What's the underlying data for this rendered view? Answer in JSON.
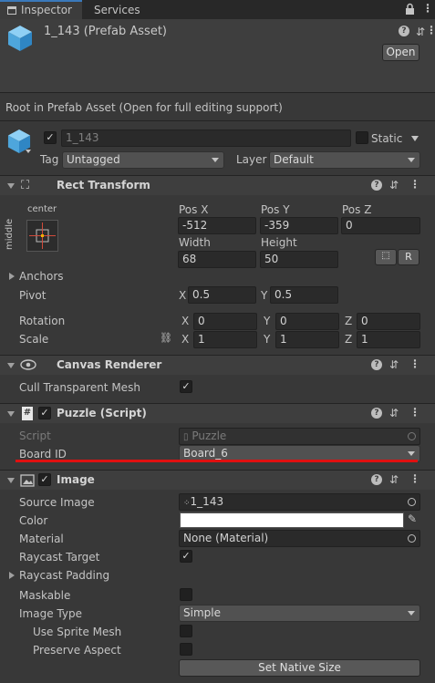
{
  "tabs": {
    "inspector": "Inspector",
    "services": "Services"
  },
  "header": {
    "asset_title": "1_143 (Prefab Asset)",
    "open_button": "Open",
    "info_text": "Root in Prefab Asset (Open for full editing support)"
  },
  "gameobject": {
    "name": "1_143",
    "static_label": "Static",
    "tag_label": "Tag",
    "tag_value": "Untagged",
    "layer_label": "Layer",
    "layer_value": "Default"
  },
  "rect_transform": {
    "title": "Rect Transform",
    "anchor_h": "center",
    "anchor_v": "middle",
    "pos_x_label": "Pos X",
    "pos_x": "-512",
    "pos_y_label": "Pos Y",
    "pos_y": "-359",
    "pos_z_label": "Pos Z",
    "pos_z": "0",
    "width_label": "Width",
    "width": "68",
    "height_label": "Height",
    "height": "50",
    "r_button": "R",
    "anchors_label": "Anchors",
    "pivot_label": "Pivot",
    "pivot_x": "0.5",
    "pivot_y": "0.5",
    "rotation_label": "Rotation",
    "rot_x": "0",
    "rot_y": "0",
    "rot_z": "0",
    "scale_label": "Scale",
    "scale_x": "1",
    "scale_y": "1",
    "scale_z": "1",
    "x": "X",
    "y": "Y",
    "z": "Z"
  },
  "canvas_renderer": {
    "title": "Canvas Renderer",
    "cull_label": "Cull Transparent Mesh"
  },
  "puzzle": {
    "title": "Puzzle (Script)",
    "script_label": "Script",
    "script_value": "Puzzle",
    "board_label": "Board ID",
    "board_value": "Board_6"
  },
  "image": {
    "title": "Image",
    "source_label": "Source Image",
    "source_value": "1_143",
    "color_label": "Color",
    "material_label": "Material",
    "material_value": "None (Material)",
    "raycast_target_label": "Raycast Target",
    "raycast_padding_label": "Raycast Padding",
    "maskable_label": "Maskable",
    "image_type_label": "Image Type",
    "image_type_value": "Simple",
    "use_sprite_mesh_label": "Use Sprite Mesh",
    "preserve_aspect_label": "Preserve Aspect",
    "native_size_button": "Set Native Size"
  },
  "colors": {
    "accent": "#3a79bb",
    "highlight": "#e01010",
    "icon_blue": "#4ea6dc"
  }
}
